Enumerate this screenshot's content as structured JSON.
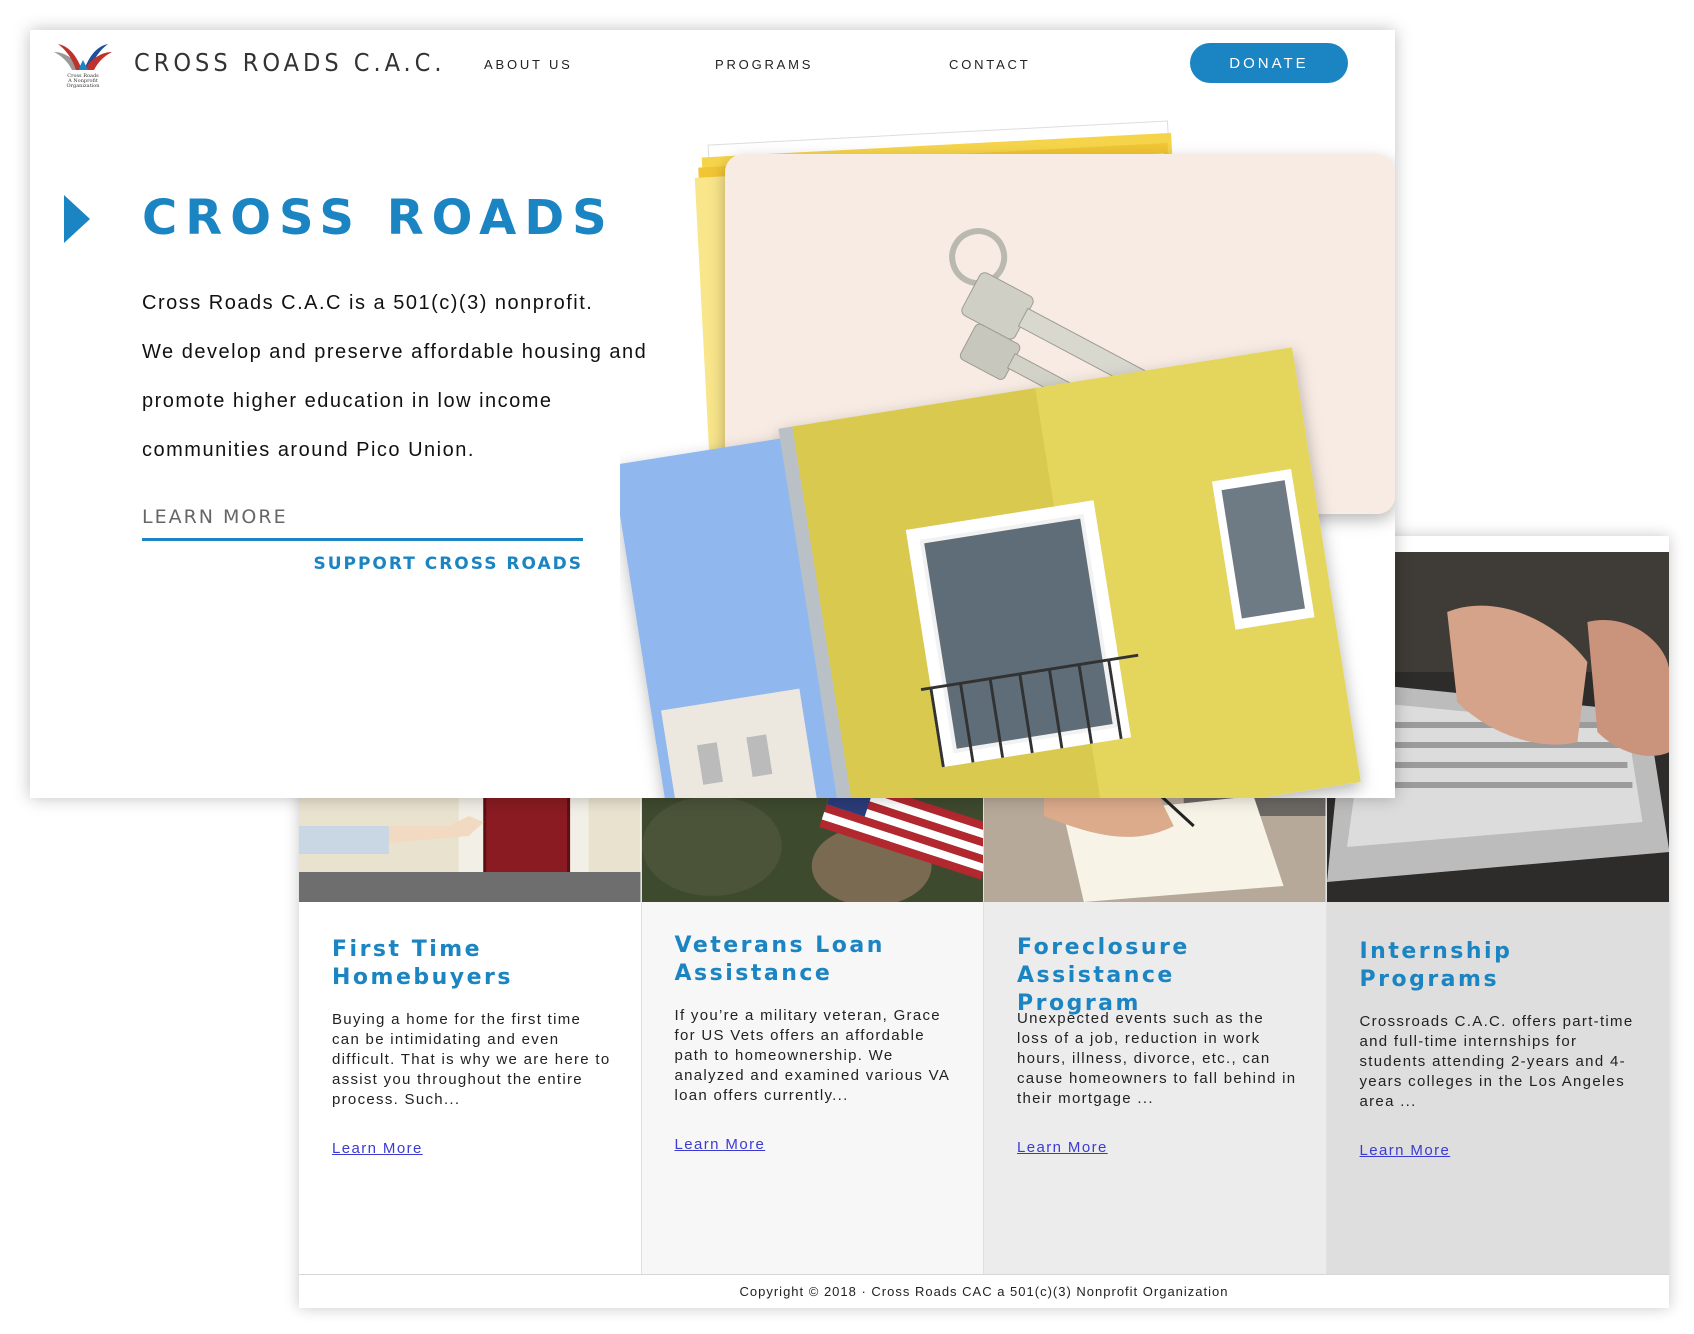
{
  "header": {
    "brand": "CROSS ROADS C.A.C.",
    "logo_caption": [
      "Cross Roads",
      "A Nonprofit Organization"
    ],
    "nav": [
      "ABOUT US",
      "PROGRAMS",
      "CONTACT"
    ],
    "donate_label": "DONATE"
  },
  "hero": {
    "title": "CROSS ROADS",
    "lines": [
      "Cross Roads C.A.C is a 501(c)(3) nonprofit.",
      "We develop and preserve affordable housing and",
      "promote higher education in low income",
      "communities around Pico Union."
    ],
    "learn_more": "LEARN MORE",
    "support": "SUPPORT CROSS ROADS"
  },
  "programs": [
    {
      "title": "First Time Homebuyers",
      "text": "Buying a home for the first time can be intimidating and even difficult. That is why we are here to assist you throughout the entire process. Such...",
      "link": "Learn More"
    },
    {
      "title": "Veterans Loan Assistance",
      "text": "If you’re a military veteran, Grace for US Vets offers an affordable path to homeownership. We analyzed and examined various VA loan offers currently...",
      "link": "Learn More"
    },
    {
      "title": "Foreclosure Assistance Program",
      "text": "Unexpected events such as the loss of a job, reduction in work hours, illness, divorce, etc., can cause homeowners to fall behind in their mortgage ...",
      "link": "Learn More"
    },
    {
      "title": "Internship Programs",
      "text": "Crossroads C.A.C. offers part-time and full-time internships for students attending 2-years and 4-years colleges in the Los Angeles area ...",
      "link": "Learn More"
    }
  ],
  "footer": {
    "copyright": "Copyright © 2018 · Cross Roads CAC a 501(c)(3) Nonprofit Organization"
  },
  "colors": {
    "accent": "#1b84c2",
    "link": "#3b3bd4",
    "card_bg": [
      "#ffffff",
      "#f7f7f7",
      "#ececec",
      "#dedede"
    ]
  }
}
